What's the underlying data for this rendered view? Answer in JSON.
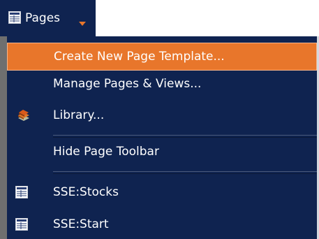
{
  "header": {
    "menu_button_label": "Pages"
  },
  "menu": {
    "items": [
      {
        "label": "Create New Page Template..."
      },
      {
        "label": "Manage Pages & Views..."
      },
      {
        "label": "Library..."
      },
      {
        "label": "Hide Page Toolbar"
      },
      {
        "label": "SSE:Stocks"
      },
      {
        "label": "SSE:Start"
      }
    ]
  },
  "colors": {
    "menu_background": "#0f2350",
    "highlight": "#e8762b",
    "gutter": "#6f6f6f",
    "text": "#ffffff"
  },
  "icons": {
    "menu_button": "page-table-icon",
    "library": "book-stack-icon",
    "page_item": "page-table-icon",
    "dropdown": "caret-down-icon"
  }
}
